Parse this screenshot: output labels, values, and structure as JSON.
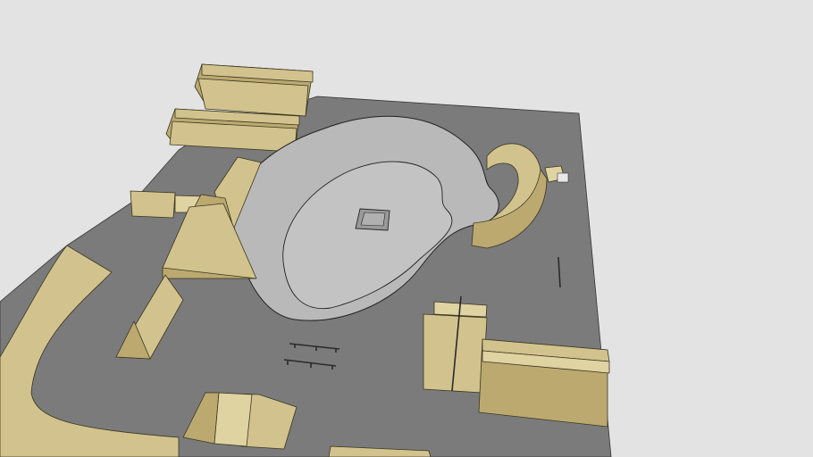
{
  "scene": {
    "colors": {
      "background": "#e3e3e3",
      "ground": "#7b7b7b",
      "bowl_surface": "#b9b9b9",
      "bowl_floor": "#c2c2c2",
      "ramp": "#d2c38e",
      "ramp_shadow": "#bba970"
    }
  }
}
